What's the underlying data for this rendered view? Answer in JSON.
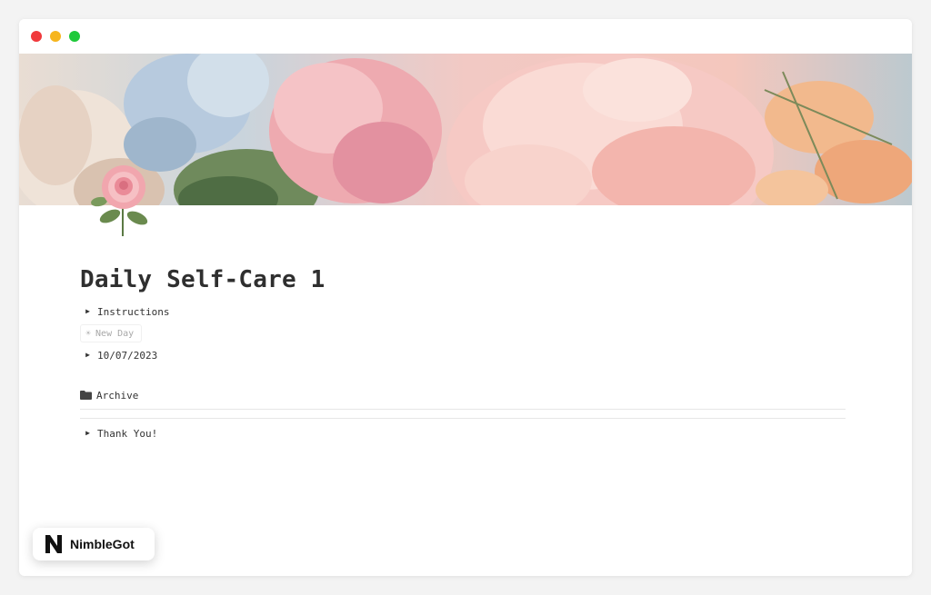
{
  "page": {
    "title": "Daily Self-Care 1",
    "icon": "rose-icon",
    "cover": "floral-painting"
  },
  "blocks": {
    "instructions_label": "Instructions",
    "new_day_label": "New Day",
    "date_label": "10/07/2023",
    "archive_label": "Archive",
    "thank_you_label": "Thank You!"
  },
  "badge": {
    "name": "NimbleGot"
  },
  "colors": {
    "close": "#f0393c",
    "minimize": "#f6b51e",
    "maximize": "#1fc93a",
    "text": "#333333",
    "muted": "#a8a8a8"
  }
}
